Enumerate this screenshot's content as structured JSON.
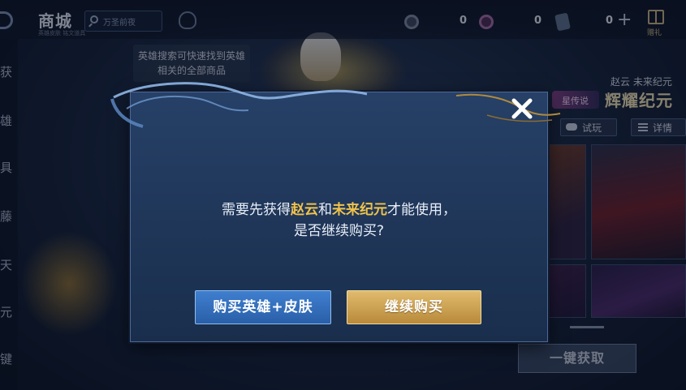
{
  "header": {
    "title": "商城",
    "subtitle": "英雄皮肤 铭文道具",
    "search_placeholder": "万圣前夜",
    "currencies": [
      {
        "icon": "coupon-token-icon",
        "value": "0"
      },
      {
        "icon": "diamond-token-icon",
        "value": "0"
      },
      {
        "icon": "voucher-icon",
        "value": "0"
      }
    ],
    "gift_label": "赠礼"
  },
  "sidebar": {
    "items": [
      "获",
      "雄",
      "具",
      "藤",
      "天",
      "元",
      "键"
    ]
  },
  "tip": {
    "text": "英雄搜索可快速找到英雄相关的全部商品"
  },
  "product": {
    "skin_name_small": "赵云 未来纪元",
    "skin_name_big": "辉耀纪元",
    "tag_label": "星传说",
    "trial_label": "试玩",
    "details_label": "详情",
    "claim_all_label": "一键获取"
  },
  "dialog": {
    "line1_prefix": "需要先获得",
    "hero_name": "赵云",
    "joiner": "和",
    "skin_name": "未来纪元",
    "line1_suffix": "才能使用，",
    "line2": "是否继续购买?",
    "buy_hero_skin_label": "购买英雄+皮肤",
    "continue_label": "继续购买"
  },
  "colors": {
    "highlight": "#f0c24b",
    "primary_button": "#2f6bb8",
    "gold_button": "#d0a654",
    "dialog_bg": "#223a5e"
  }
}
